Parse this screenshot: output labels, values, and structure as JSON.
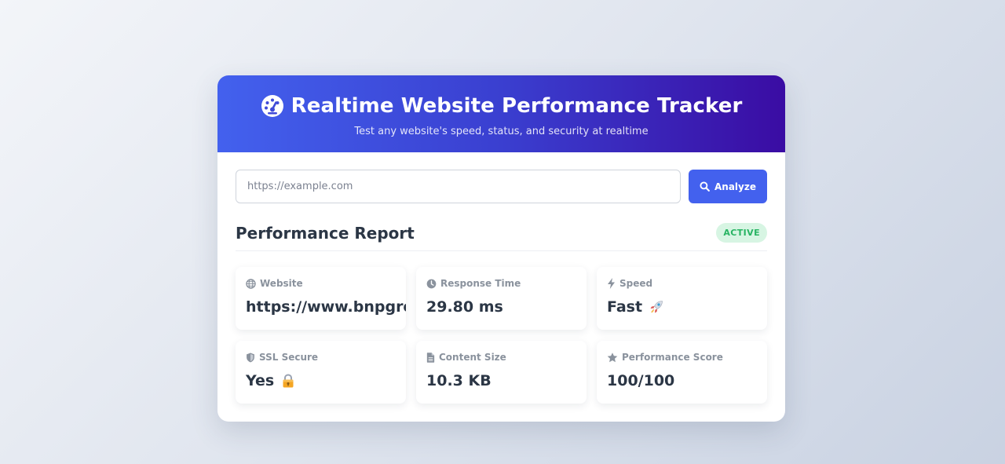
{
  "header": {
    "title": "Realtime Website Performance Tracker",
    "subtitle": "Test any website's speed, status, and security at realtime",
    "icon": "gauge-icon"
  },
  "search": {
    "placeholder": "https://example.com",
    "value": "",
    "button_label": "Analyze",
    "button_icon": "search-icon"
  },
  "report": {
    "title": "Performance Report",
    "status": "ACTIVE"
  },
  "metrics": [
    {
      "label": "Website",
      "value": "https://www.bnpgroup.com",
      "icon": "globe-icon"
    },
    {
      "label": "Response Time",
      "value": "29.80 ms",
      "icon": "clock-icon"
    },
    {
      "label": "Speed",
      "value": "Fast",
      "icon": "bolt-icon",
      "emoji": "rocket-icon"
    },
    {
      "label": "SSL Secure",
      "value": "Yes",
      "icon": "shield-icon",
      "emoji": "lock-icon"
    },
    {
      "label": "Content Size",
      "value": "10.3 KB",
      "icon": "file-icon"
    },
    {
      "label": "Performance Score",
      "value": "100/100",
      "icon": "star-icon"
    }
  ],
  "colors": {
    "accent": "#4361ee",
    "header_end": "#3a0ca3",
    "text_dark": "#2b3645",
    "label": "#8a929d",
    "status_bg": "#d7f5e3",
    "status_text": "#28b463"
  }
}
